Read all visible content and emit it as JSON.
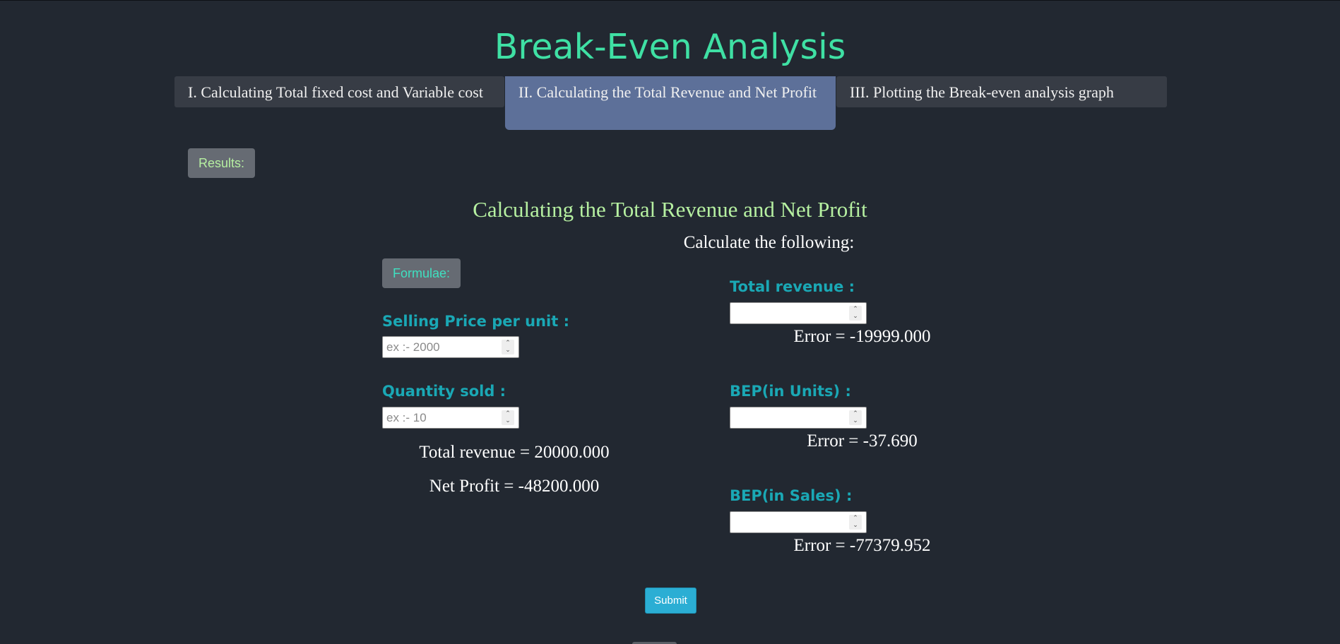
{
  "page": {
    "title": "Break-Even Analysis"
  },
  "tabs": [
    {
      "label": "I. Calculating Total fixed cost and Variable cost",
      "active": false
    },
    {
      "label": "II. Calculating the Total Revenue and Net Profit",
      "active": true
    },
    {
      "label": "III. Plotting the Break-even analysis graph",
      "active": false
    }
  ],
  "results_button": "Results:",
  "section": {
    "title": "Calculating the Total Revenue and Net Profit",
    "instruction": "Calculate the following:"
  },
  "formulae_button": "Formulae:",
  "inputs": {
    "selling_price": {
      "label": "Selling Price per unit :",
      "placeholder": "ex :- 2000",
      "value": ""
    },
    "quantity_sold": {
      "label": "Quantity sold :",
      "placeholder": "ex :- 10",
      "value": ""
    }
  },
  "computed": {
    "total_revenue": "Total revenue = 20000.000",
    "net_profit": "Net Profit = -48200.000"
  },
  "answers": {
    "total_revenue": {
      "label": "Total revenue :",
      "value": "",
      "error": "Error = -19999.000"
    },
    "bep_units": {
      "label": "BEP(in Units) :",
      "value": "",
      "error": "Error = -37.690"
    },
    "bep_sales": {
      "label": "BEP(in Sales) :",
      "value": "",
      "error": "Error = -77379.952"
    }
  },
  "submit_button": "Submit",
  "icons": {
    "spinner": "number-spinner-icon"
  },
  "colors": {
    "background": "#222831",
    "title": "#3fe0a4",
    "section_title": "#b6f0a1",
    "field_label": "#1aa8b5",
    "active_tab": "#5d7099",
    "submit": "#2baed4"
  }
}
